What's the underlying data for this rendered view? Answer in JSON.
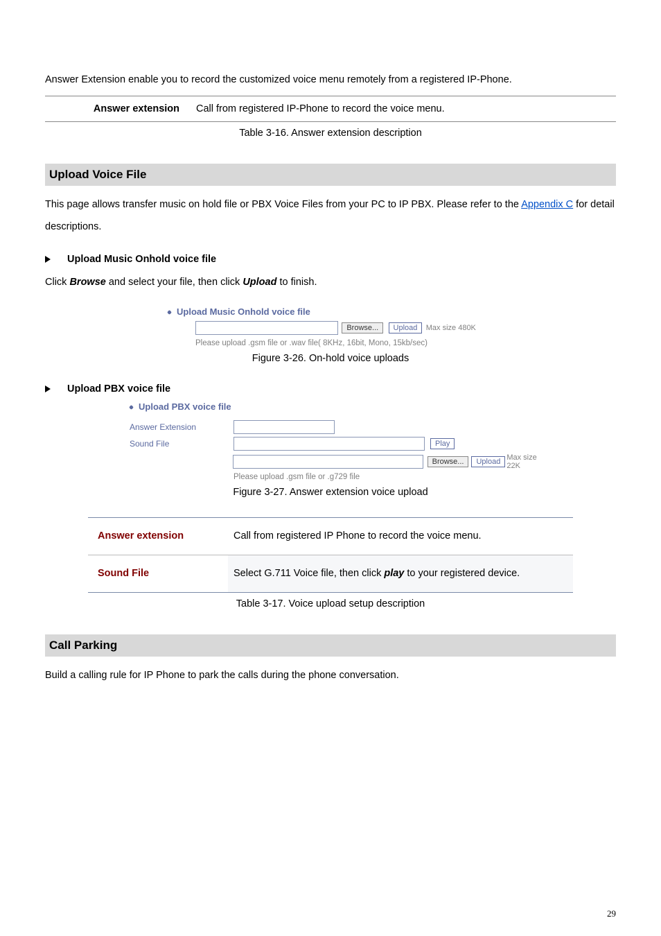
{
  "intro": {
    "paragraph": "Answer Extension enable you to record the customized voice menu remotely from a registered IP-Phone."
  },
  "table1": {
    "label": "Answer extension",
    "value": "Call from registered IP-Phone to record the voice menu.",
    "caption": "Table 3-16. Answer extension description"
  },
  "section_upload": {
    "heading": "Upload Voice File",
    "para_before": "This page allows transfer music on hold file or PBX Voice Files from your PC to IP PBX. Please refer to the ",
    "link_text": "Appendix C",
    "para_after": " for detail descriptions."
  },
  "bullet_music": {
    "title": "Upload Music Onhold voice file",
    "click_text": "Click ",
    "browse_word": "Browse",
    "mid_text": " and select your file, then click ",
    "upload_word": "Upload",
    "end_text": " to finish."
  },
  "fig26": {
    "title": "Upload Music Onhold voice file",
    "browse_btn": "Browse...",
    "upload_btn": "Upload",
    "maxsize": "Max size 480K",
    "constraint": "Please upload .gsm file or .wav file( 8KHz, 16bit, Mono, 15kb/sec)",
    "caption": "Figure 3-26. On-hold voice uploads"
  },
  "bullet_pbx": {
    "title": "Upload PBX voice file"
  },
  "fig27": {
    "title": "Upload PBX voice file",
    "row1_label": "Answer Extension",
    "row2_label": "Sound File",
    "play_btn": "Play",
    "browse_btn": "Browse...",
    "upload_btn": "Upload",
    "maxsize": "Max size 22K",
    "constraint": "Please upload .gsm file or .g729 file",
    "caption": "Figure 3-27. Answer extension voice upload"
  },
  "table2": {
    "r1_label": "Answer extension",
    "r1_value": "Call from registered IP Phone to record the voice menu.",
    "r2_label": "Sound File",
    "r2_before": "Select G.711 Voice file, then click ",
    "r2_bold": "play",
    "r2_after": " to your registered device.",
    "caption": "Table 3-17. Voice upload setup description"
  },
  "section_call": {
    "heading": "Call Parking",
    "para": "Build a calling rule for IP Phone to park the calls during the phone conversation."
  },
  "pagenum": "29"
}
